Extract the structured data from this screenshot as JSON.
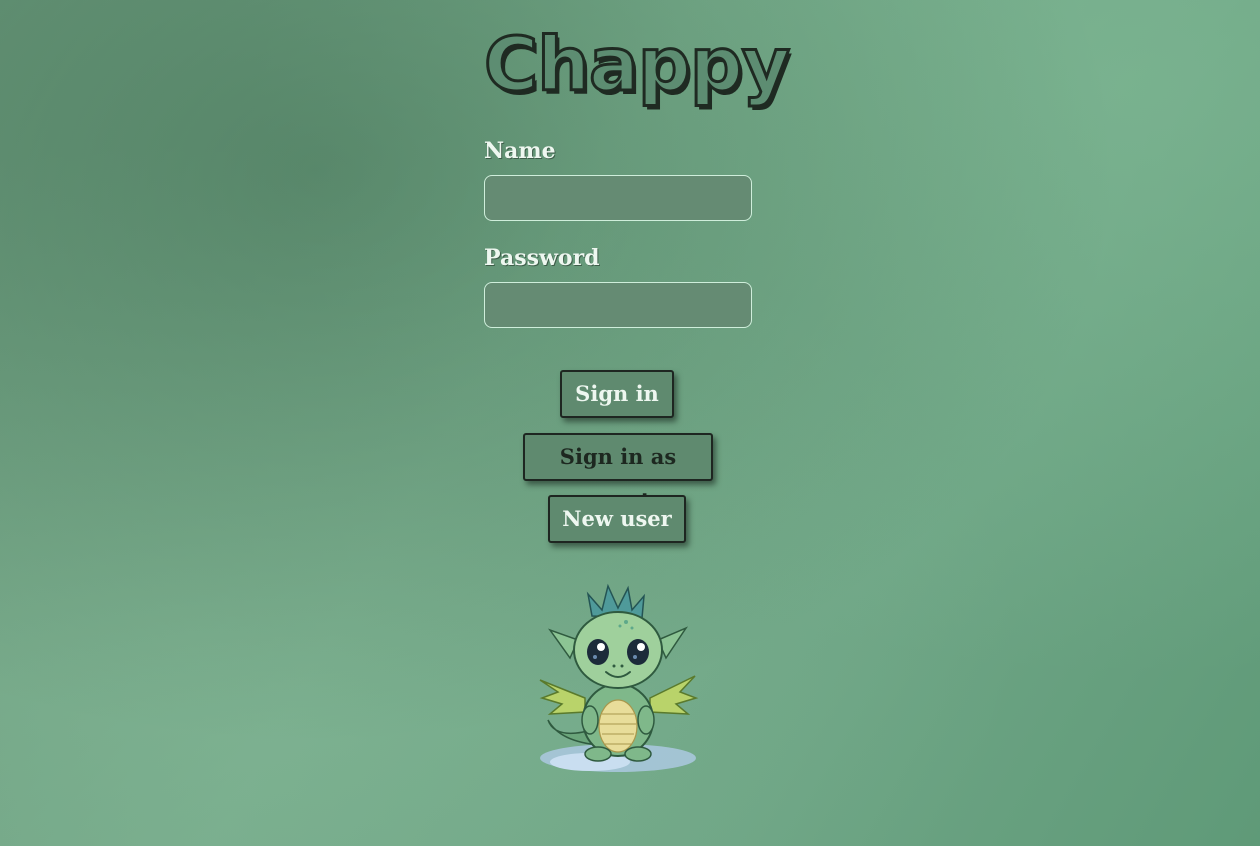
{
  "app": {
    "title": "Chappy"
  },
  "form": {
    "name_label": "Name",
    "name_value": "",
    "password_label": "Password",
    "password_value": ""
  },
  "buttons": {
    "sign_in": "Sign in",
    "sign_in_guest": "Sign in as guest",
    "new_user": "New user"
  },
  "colors": {
    "background": "#6ea585",
    "button_bg": "#5f8a6f",
    "input_bg": "#658b73",
    "text_light": "#eef7f0",
    "border_dark": "#1e2621"
  },
  "mascot": {
    "icon": "baby-dragon-icon"
  }
}
